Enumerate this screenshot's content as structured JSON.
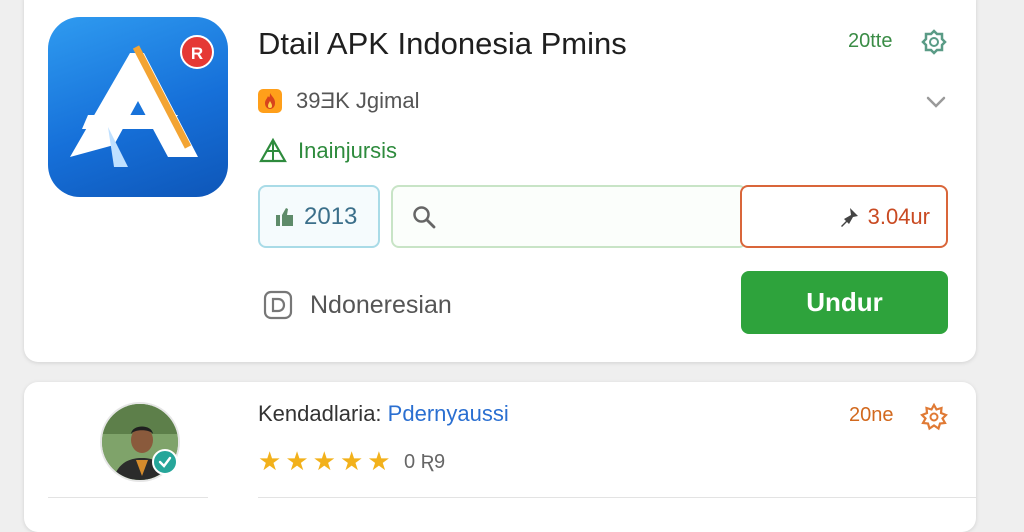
{
  "app": {
    "title": "Dtail APK Indonesia Pmins",
    "date": "20tte",
    "badge_text": "R",
    "downloads": "39ƎK Jgimal",
    "category": "Inainjursis",
    "version": "2013",
    "size": "3.04ur",
    "language": "Ndoneresian",
    "download_button": "Undur"
  },
  "review": {
    "name": "Kendadlaria:",
    "role": "Pdernyaussi",
    "date": "20ne",
    "rating_text": "0 Ʀ9",
    "stars": 5
  },
  "colors": {
    "green": "#2ea33c",
    "orange": "#d9663a",
    "blue_link": "#2a6fd1",
    "star": "#f2b11b"
  },
  "icons": [
    "app-logo-icon",
    "gear-icon",
    "fire-icon",
    "chevron-down-icon",
    "tent-icon",
    "thumbs-up-icon",
    "search-icon",
    "pin-icon",
    "language-icon",
    "verified-check-icon",
    "settings-cog-icon",
    "star-icon"
  ]
}
